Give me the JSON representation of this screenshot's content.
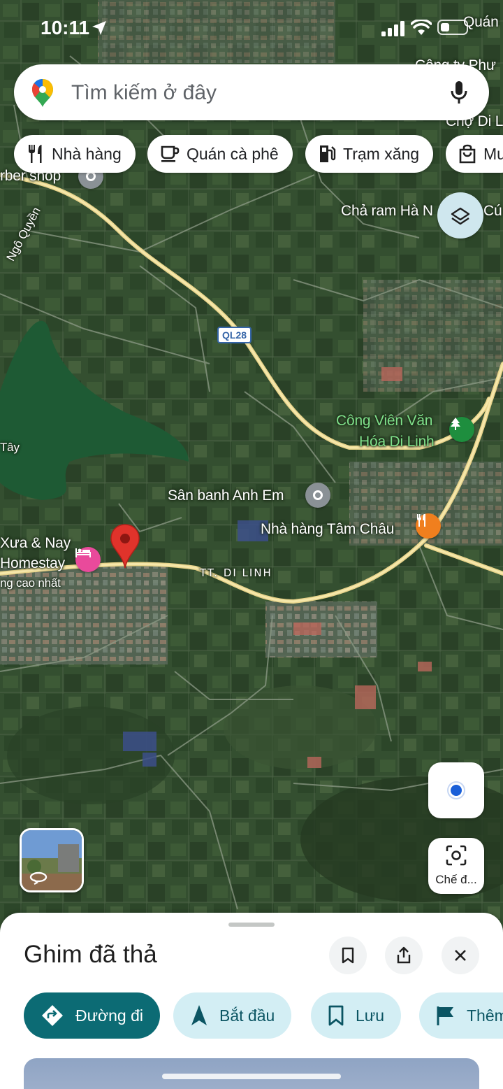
{
  "status_bar": {
    "time": "10:11"
  },
  "search": {
    "placeholder": "Tìm kiếm ở đây"
  },
  "chips": [
    {
      "label": "Nhà hàng",
      "icon": "fork-knife-icon"
    },
    {
      "label": "Quán cà phê",
      "icon": "coffee-cup-icon"
    },
    {
      "label": "Trạm xăng",
      "icon": "gas-station-icon"
    },
    {
      "label": "Mu",
      "icon": "shopping-bag-icon"
    }
  ],
  "map": {
    "labels": {
      "quan": "Quán",
      "cong_ty": "Công ty Phư",
      "cho": "Chợ Di L",
      "barber": "rber shop",
      "ngo_quyen": "Ngô Quyền",
      "cha_ram": "Chả ram Hà N",
      "cu": "Cú",
      "ql28": "QL28",
      "tay": "Tây",
      "cong_vien_1": "Công Viên Văn",
      "cong_vien_2": "Hóa Di Linh",
      "san_banh": "Sân banh Anh Em",
      "nha_hang": "Nhà hàng Tâm Châu",
      "xua_nay_1": "Xưa & Nay",
      "xua_nay_2": "Homestay",
      "xua_nay_3": "ng cao nhất",
      "tt_di_linh": "TT. DI LINH"
    },
    "colors": {
      "pin": "#e0332b",
      "hotel": "#e94a9b",
      "restaurant": "#f07f1e",
      "park": "#1e8e3e",
      "place": "#8a9196"
    }
  },
  "controls": {
    "lens_label": "Chế đ..."
  },
  "sheet": {
    "title": "Ghim đã thả",
    "actions": [
      {
        "label": "Đường đi",
        "icon": "directions-icon"
      },
      {
        "label": "Bắt đầu",
        "icon": "navigation-arrow-icon"
      },
      {
        "label": "Lưu",
        "icon": "bookmark-icon"
      },
      {
        "label": "Thêm",
        "icon": "flag-icon"
      }
    ]
  }
}
